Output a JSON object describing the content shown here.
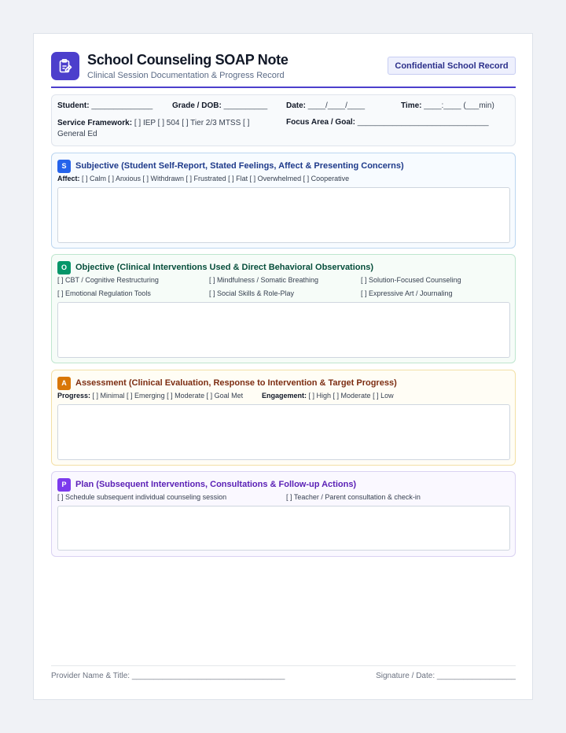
{
  "header": {
    "logo_icon": "clipboard-edit-icon",
    "title": "School Counseling SOAP Note",
    "subtitle": "Clinical Session Documentation & Progress Record",
    "badge": "Confidential School Record",
    "accent_color": "#4c3fcc"
  },
  "info": {
    "student": {
      "label": "Student:",
      "value": "______________"
    },
    "grade": {
      "label": "Grade / DOB:",
      "value": "__________"
    },
    "date": {
      "label": "Date:",
      "value": "____/____/____"
    },
    "time": {
      "label": "Time:",
      "value": "____:____ (___min)"
    },
    "framework": {
      "label": "Service Framework:",
      "value": "[ ] IEP [ ] 504 [ ] Tier 2/3 MTSS [ ] General Ed"
    },
    "focus": {
      "label": "Focus Area / Goal:",
      "value": "______________________________"
    }
  },
  "subjective": {
    "letter": "S",
    "title": "Subjective (Student Self-Report, Stated Feelings, Affect & Presenting Concerns)",
    "affect_label": "Affect:",
    "affect_options": "[ ] Calm [ ] Anxious [ ] Withdrawn [ ] Frustrated [ ] Flat [ ] Overwhelmed [ ] Cooperative",
    "color": "#2563eb"
  },
  "objective": {
    "letter": "O",
    "title": "Objective (Clinical Interventions Used & Direct Behavioral Observations)",
    "items": [
      "[ ] CBT / Cognitive Restructuring",
      "[ ] Mindfulness / Somatic Breathing",
      "[ ] Solution-Focused Counseling",
      "[ ] Emotional Regulation Tools",
      "[ ] Social Skills & Role-Play",
      "[ ] Expressive Art / Journaling"
    ],
    "color": "#059669"
  },
  "assessment": {
    "letter": "A",
    "title": "Assessment (Clinical Evaluation, Response to Intervention & Target Progress)",
    "progress_label": "Progress:",
    "progress_options": "[ ] Minimal [ ] Emerging [ ] Moderate [ ] Goal Met",
    "engagement_label": "Engagement:",
    "engagement_options": "[ ] High [ ] Moderate [ ] Low",
    "color": "#d97706"
  },
  "plan": {
    "letter": "P",
    "title": "Plan (Subsequent Interventions, Consultations & Follow-up Actions)",
    "items": [
      "[ ] Schedule subsequent individual counseling session",
      "[ ] Teacher / Parent consultation & check-in"
    ],
    "color": "#7c3aed"
  },
  "footer": {
    "provider_label": "Provider Name & Title:",
    "provider_line": "___________________________________",
    "signature_label": "Signature / Date:",
    "signature_line": "__________________"
  }
}
